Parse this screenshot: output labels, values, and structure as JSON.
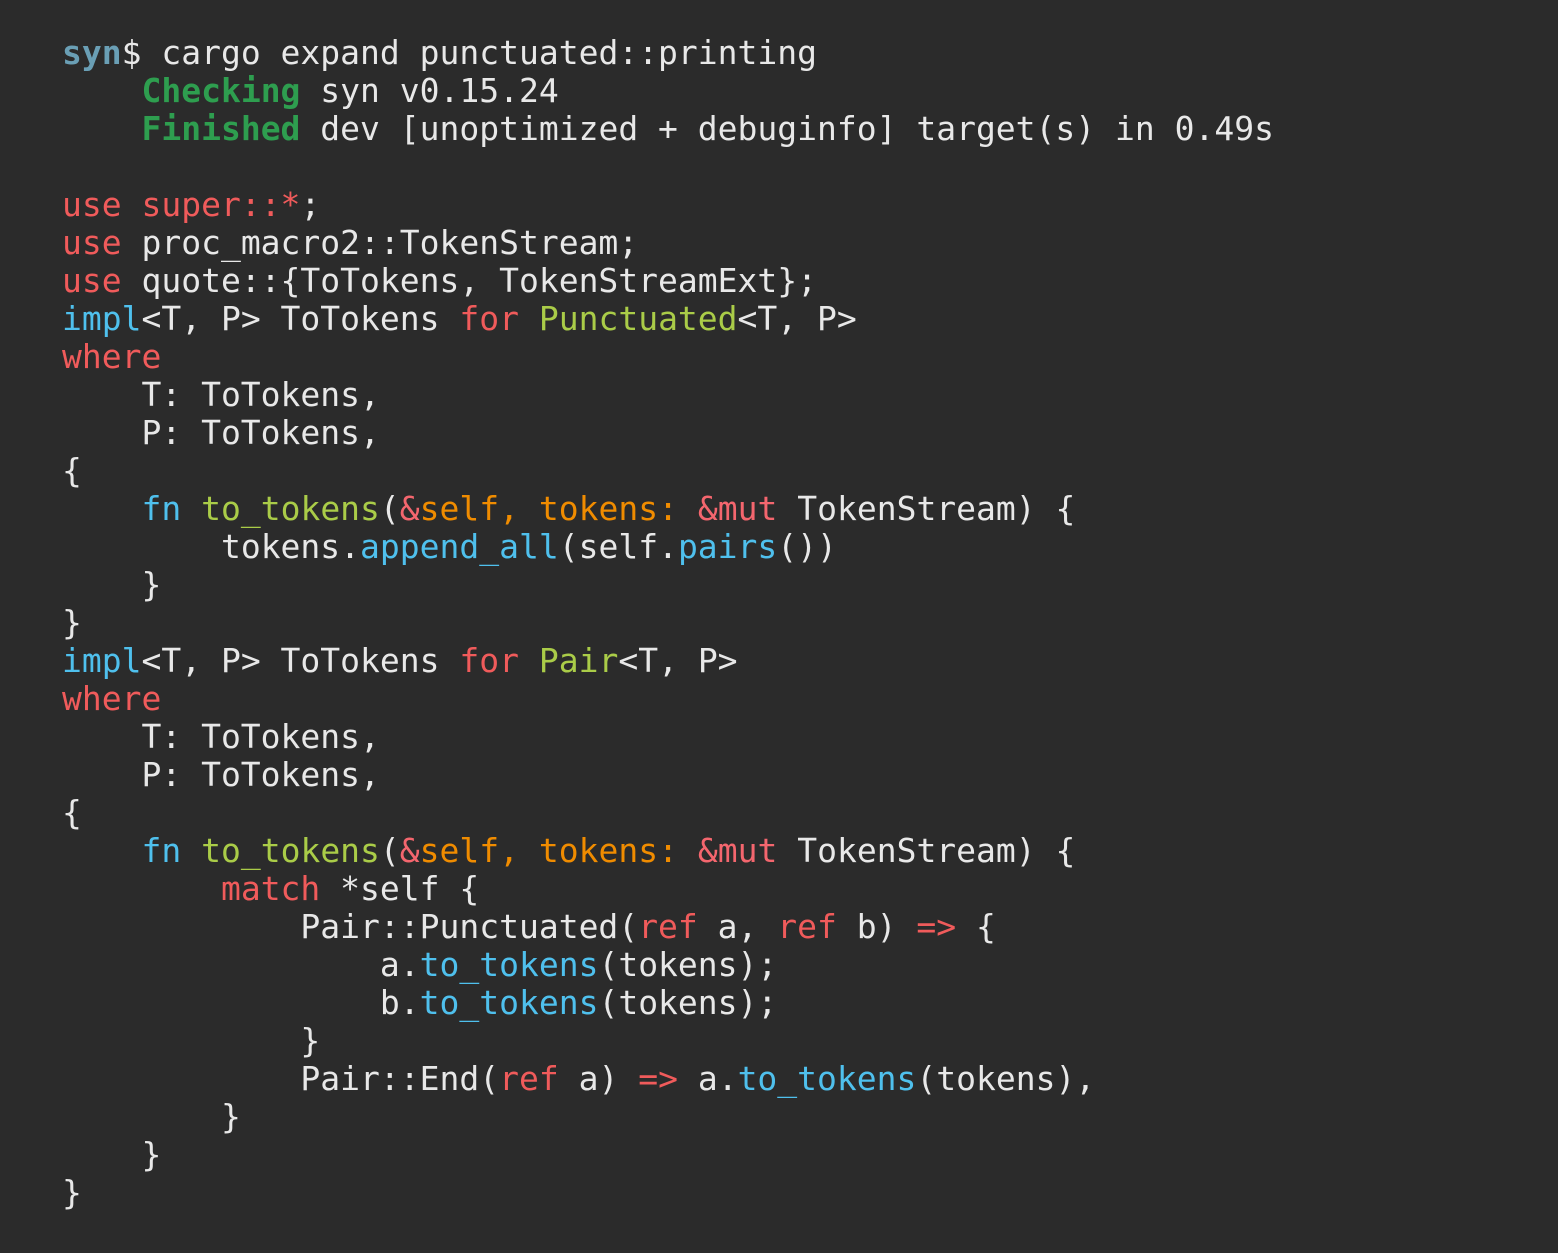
{
  "terminal": {
    "background_color": "#2b2b2b",
    "default_text_color": "#e8e8e8",
    "prompt_color": "#6a9fb5",
    "status_color": "#2e9e4f",
    "keyword_color": "#f05b5b",
    "type_color": "#aacc48",
    "function_color": "#4fc0ed",
    "param_color": "#f08c00",
    "prompt_host": "syn",
    "prompt_symbol": "$",
    "command": " cargo expand punctuated::printing",
    "build_status": [
      {
        "label": "Checking",
        "indent": "    ",
        "text": " syn v0.15.24"
      },
      {
        "label": "Finished",
        "indent": "    ",
        "text": " dev [unoptimized + debuginfo] target(s) in 0.49s"
      }
    ],
    "crate_name": "syn",
    "crate_version": "v0.15.24",
    "build_profile": "dev",
    "build_flags": "[unoptimized + debuginfo]",
    "build_time": "0.49s"
  },
  "code": {
    "l01": {
      "kw": "use",
      "rest1": " ",
      "kw2": "super::*",
      "rest2": ";"
    },
    "l02": {
      "kw": "use",
      "rest": " proc_macro2::TokenStream;"
    },
    "l03": {
      "kw": "use",
      "rest": " quote::{ToTokens, TokenStreamExt};"
    },
    "l04": {
      "kw": "impl",
      "gen": "<T, P> ToTokens ",
      "forkw": "for",
      "sp": " ",
      "type": "Punctuated",
      "tail": "<T, P>"
    },
    "l05": {
      "kw": "where"
    },
    "l06": {
      "text": "    T: ToTokens,"
    },
    "l07": {
      "text": "    P: ToTokens,"
    },
    "l08": {
      "text": "{"
    },
    "l09": {
      "indent": "    ",
      "fnkw": "fn",
      "sp": " ",
      "name": "to_tokens",
      "p1": "(",
      "amp1": "&",
      "self1": "self",
      "comma": ", ",
      "param": "tokens",
      "colon": ":",
      "sp2": " ",
      "ampmut": "&mut",
      "sp3": " ",
      "type": "TokenStream",
      "tail": ") {"
    },
    "l10": {
      "indent": "        ",
      "recv": "tokens.",
      "call": "append_all",
      "mid": "(self.",
      "call2": "pairs",
      "tail": "())"
    },
    "l11": {
      "text": "    }"
    },
    "l12": {
      "text": "}"
    },
    "l13": {
      "kw": "impl",
      "gen": "<T, P> ToTokens ",
      "forkw": "for",
      "sp": " ",
      "type": "Pair",
      "tail": "<T, P>"
    },
    "l14": {
      "kw": "where"
    },
    "l15": {
      "text": "    T: ToTokens,"
    },
    "l16": {
      "text": "    P: ToTokens,"
    },
    "l17": {
      "text": "{"
    },
    "l18": {
      "indent": "    ",
      "fnkw": "fn",
      "sp": " ",
      "name": "to_tokens",
      "p1": "(",
      "amp1": "&",
      "self1": "self",
      "comma": ", ",
      "param": "tokens",
      "colon": ":",
      "sp2": " ",
      "ampmut": "&mut",
      "sp3": " ",
      "type": "TokenStream",
      "tail": ") {"
    },
    "l19": {
      "indent": "        ",
      "kw": "match",
      "rest": " *self {"
    },
    "l20": {
      "indent": "            ",
      "pre": "Pair::Punctuated(",
      "ref1": "ref",
      "mid1": " a, ",
      "ref2": "ref",
      "mid2": " b) ",
      "arrow": "=>",
      "tail": " {"
    },
    "l21": {
      "indent": "                ",
      "recv": "a.",
      "call": "to_tokens",
      "tail": "(tokens);"
    },
    "l22": {
      "indent": "                ",
      "recv": "b.",
      "call": "to_tokens",
      "tail": "(tokens);"
    },
    "l23": {
      "text": "            }"
    },
    "l24": {
      "indent": "            ",
      "pre": "Pair::End(",
      "refkw": "ref",
      "mid": " a) ",
      "arrow": "=>",
      "mid2": " a.",
      "call": "to_tokens",
      "tail": "(tokens),"
    },
    "l25": {
      "text": "        }"
    },
    "l26": {
      "text": "    }"
    },
    "l27": {
      "text": "}"
    }
  }
}
